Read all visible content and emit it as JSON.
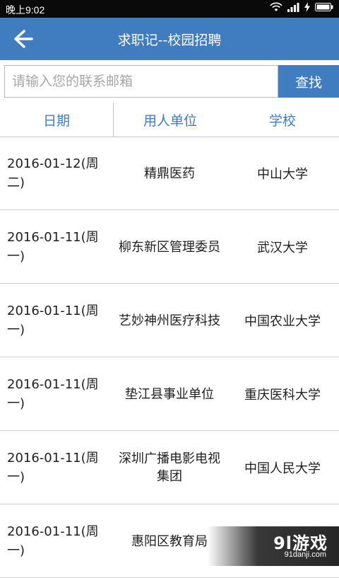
{
  "status_bar": {
    "time": "晚上9:02",
    "icons": [
      "wifi-icon",
      "signal-icon",
      "charging-icon",
      "battery-icon"
    ]
  },
  "app_bar": {
    "title": "求职记--校园招聘",
    "back_icon": "arrow-left-icon"
  },
  "search": {
    "placeholder": "请输入您的联系邮箱",
    "value": "",
    "button_label": "查找"
  },
  "table": {
    "columns": [
      "日期",
      "用人单位",
      "学校"
    ],
    "rows": [
      {
        "date": "2016-01-12(周二)",
        "employer": "精鼎医药",
        "school": "中山大学"
      },
      {
        "date": "2016-01-11(周一)",
        "employer": "柳东新区管理委员",
        "school": "武汉大学"
      },
      {
        "date": "2016-01-11(周一)",
        "employer": "艺妙神州医疗科技",
        "school": "中国农业大学"
      },
      {
        "date": "2016-01-11(周一)",
        "employer": "垫江县事业单位",
        "school": "重庆医科大学"
      },
      {
        "date": "2016-01-11(周一)",
        "employer": "深圳广播电影电视集团",
        "school": "中国人民大学"
      },
      {
        "date": "2016-01-11(周一)",
        "employer": "惠阳区教育局",
        "school": ""
      }
    ]
  },
  "watermark": {
    "logo": "9l游戏",
    "url": "91danji.com"
  },
  "colors": {
    "primary": "#3f7cc0",
    "status_bar": "#0a0a0a",
    "divider": "#cfcfcf"
  }
}
